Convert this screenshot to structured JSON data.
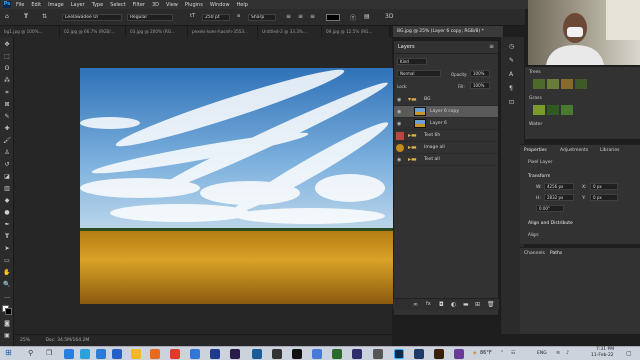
{
  "menubar": {
    "logo": "Ps",
    "items": [
      "File",
      "Edit",
      "Image",
      "Layer",
      "Type",
      "Select",
      "Filter",
      "3D",
      "View",
      "Plugins",
      "Window",
      "Help"
    ]
  },
  "options": {
    "font_family": "Leelawadee UI",
    "font_style": "Regular",
    "font_size": "250 pt",
    "anti_alias": "Sharp"
  },
  "tabs": [
    "bg1.jpg @ 100%...",
    "02.jpg @ 66.7% (RGB/...",
    "03.jpg @ 200% (RG...",
    "pexels-koes-hasnih-3553...",
    "Untitled-2 @ 33.3%...",
    "09.jpg @ 12.5% (RG..."
  ],
  "active_doc": "BG.jpg @ 25% (Layer 6 copy, RGB/8) *",
  "layers": {
    "title": "Layers",
    "kind": "Kind",
    "blend": "Normal",
    "opacity_label": "Opacity:",
    "opacity": "100%",
    "fill_label": "Fill:",
    "fill": "100%",
    "lock_label": "Lock:",
    "rows": [
      "BG",
      "Layer 6 copy",
      "Layer 6",
      "Text 6h",
      "Image all",
      "Text all"
    ]
  },
  "swatches": {
    "groups": [
      "Trees",
      "Grass",
      "Water"
    ]
  },
  "properties": {
    "tabs": [
      "Properties",
      "Adjustments",
      "Libraries"
    ],
    "pixel_layer": "Pixel Layer",
    "transform": "Transform",
    "w_label": "W:",
    "w_val": "4256 px",
    "h_label": "H:",
    "h_val": "2832 px",
    "x_label": "X:",
    "x_val": "0 px",
    "y_label": "Y:",
    "y_val": "0 px",
    "angle": "0.00°",
    "align": "Align and Distribute",
    "align_sub": "Align:"
  },
  "channels": {
    "tabs": [
      "Channels",
      "Paths"
    ]
  },
  "status": {
    "zoom": "25%",
    "doc": "Doc: 34.5M/164.2M"
  },
  "taskbar": {
    "weather": "86°F",
    "lang": "ENG",
    "time": "7:31 PM",
    "date": "11-Feb-22"
  }
}
